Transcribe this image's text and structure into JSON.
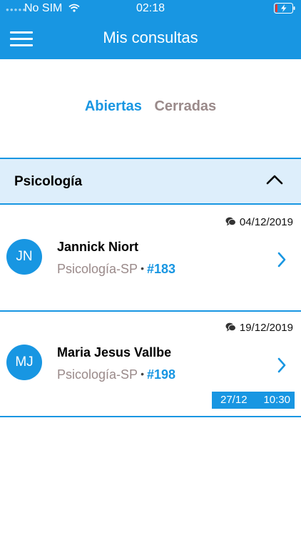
{
  "status_bar": {
    "carrier": "No SIM",
    "time": "02:18"
  },
  "header": {
    "title": "Mis consultas",
    "menu_icon": "hamburger-menu-icon"
  },
  "tabs": [
    {
      "label": "Abiertas",
      "active": true
    },
    {
      "label": "Cerradas",
      "active": false
    }
  ],
  "section": {
    "title": "Psicología",
    "expanded": true
  },
  "consultations": [
    {
      "date": "04/12/2019",
      "initials": "JN",
      "name": "Jannick Niort",
      "specialty": "Psicología-SP",
      "separator": "•",
      "number": "#183"
    },
    {
      "date": "19/12/2019",
      "initials": "MJ",
      "name": "Maria Jesus Vallbe",
      "specialty": "Psicología-SP",
      "separator": "•",
      "number": "#198",
      "appointment": {
        "date": "27/12",
        "time": "10:30"
      }
    }
  ],
  "colors": {
    "primary": "#1896e2",
    "section_background": "#ddeefb",
    "muted_text": "#9a8a8a"
  }
}
